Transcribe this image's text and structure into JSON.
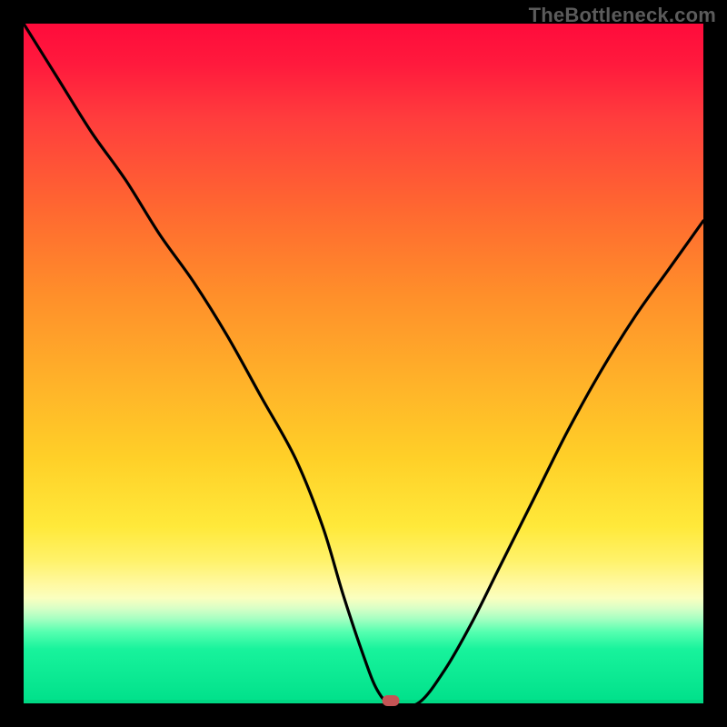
{
  "watermark": "TheBottleneck.com",
  "chart_data": {
    "type": "line",
    "title": "",
    "xlabel": "",
    "ylabel": "",
    "xlim": [
      0,
      100
    ],
    "ylim": [
      0,
      100
    ],
    "grid": false,
    "series": [
      {
        "name": "bottleneck-curve",
        "color": "#000000",
        "x": [
          0,
          5,
          10,
          15,
          20,
          25,
          30,
          35,
          40,
          44,
          47,
          50,
          52,
          54,
          58,
          62,
          66,
          70,
          75,
          80,
          85,
          90,
          95,
          100
        ],
        "values": [
          100,
          92,
          84,
          77,
          69,
          62,
          54,
          45,
          36,
          26,
          16,
          7,
          2,
          0,
          0,
          5,
          12,
          20,
          30,
          40,
          49,
          57,
          64,
          71
        ]
      }
    ],
    "marker": {
      "x": 54,
      "y": 0,
      "color": "#c55455"
    },
    "background_gradient": {
      "top": "#ff0b3b",
      "mid": "#ffe93a",
      "bottom": "#00e08a"
    }
  }
}
